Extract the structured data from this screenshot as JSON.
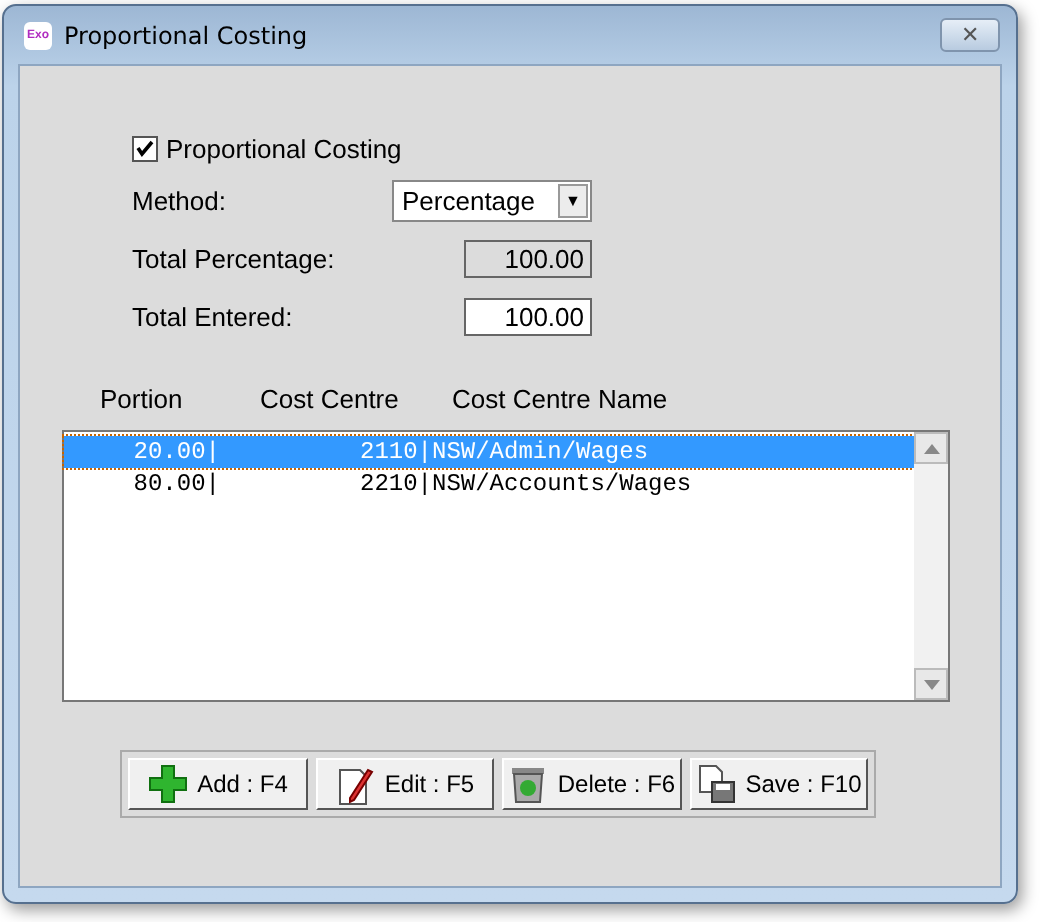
{
  "window": {
    "title": "Proportional Costing",
    "app_icon_text": "Exo",
    "close_glyph": "✕"
  },
  "proportional_costing": {
    "label": "Proportional Costing",
    "checked": true
  },
  "method": {
    "label": "Method:",
    "value": "Percentage",
    "arrow": "▼"
  },
  "fields": [
    {
      "label": "Total Percentage:",
      "value": "100.00",
      "disabled": true
    },
    {
      "label": "Total Entered:",
      "value": "100.00",
      "disabled": false
    }
  ],
  "table": {
    "columns": [
      "Portion",
      "Cost Centre",
      "Cost Centre Name"
    ],
    "rows": [
      {
        "portion": "20.00|",
        "cost_centre": "2110|NSW/Admin/Wages",
        "selected": true
      },
      {
        "portion": "80.00|",
        "cost_centre": "2210|NSW/Accounts/Wages",
        "selected": false
      }
    ]
  },
  "buttons": [
    {
      "kind": "add",
      "label": "Add : F4"
    },
    {
      "kind": "edit",
      "label": "Edit : F5"
    },
    {
      "kind": "delete",
      "label": "Delete : F6"
    },
    {
      "kind": "save",
      "label": "Save : F10"
    }
  ]
}
